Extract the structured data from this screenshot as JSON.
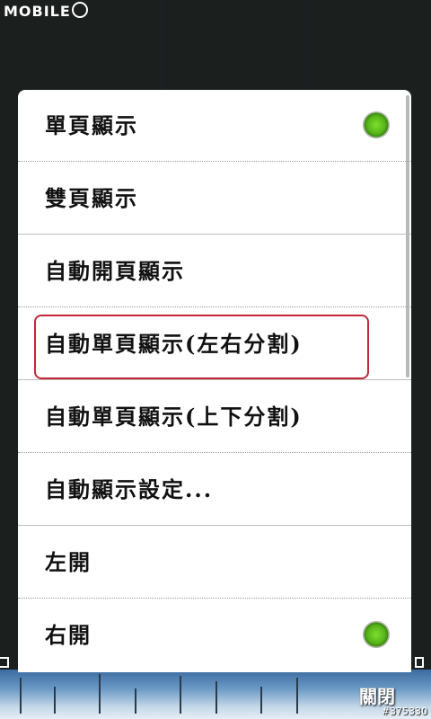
{
  "watermark": {
    "top": "MOBILE",
    "bottom": "#375330"
  },
  "menu": {
    "items": [
      {
        "label": "單頁顯示",
        "selected": true
      },
      {
        "label": "雙頁顯示",
        "selected": false
      },
      {
        "label": "自動開頁顯示",
        "selected": false
      },
      {
        "label": "自動單頁顯示(左右分割)",
        "selected": false,
        "annotated": true
      },
      {
        "label": "自動單頁顯示(上下分割)",
        "selected": false
      },
      {
        "label": "自動顯示設定...",
        "selected": false
      },
      {
        "label": "左開",
        "selected": false
      },
      {
        "label": "右開",
        "selected": true
      }
    ]
  },
  "footer": {
    "label": "關閉"
  },
  "colors": {
    "radio_on": "#58b61a",
    "annotation": "#c0283a",
    "background": "#1b1f1e"
  }
}
